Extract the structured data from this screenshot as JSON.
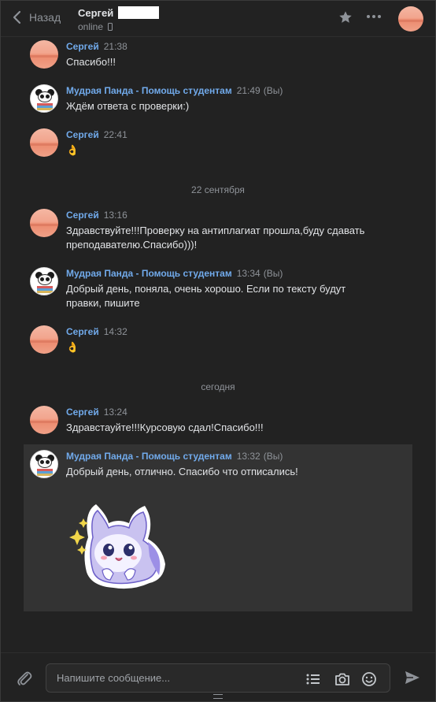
{
  "header": {
    "back_label": "Назад",
    "peer_name": "Сергей",
    "peer_status": "online"
  },
  "messages": [
    {
      "author": "Сергей",
      "time": "21:38",
      "you": "",
      "text": "Спасибо!!!",
      "avatar": "sunset-avatar"
    },
    {
      "author": "Мудрая Панда - Помощь студентам",
      "time": "21:49",
      "you": "(Вы)",
      "text": "Ждём ответа с проверки:)",
      "avatar": "panda-avatar"
    },
    {
      "author": "Сергей",
      "time": "22:41",
      "you": "",
      "text": "👌",
      "avatar": "sunset-avatar"
    },
    {
      "author": "Сергей",
      "time": "13:16",
      "you": "",
      "text": "Здравствуйте!!!Проверку на антиплагиат прошла,буду сдавать преподавателю.Спасибо)))!",
      "avatar": "sunset-avatar"
    },
    {
      "author": "Мудрая Панда - Помощь студентам",
      "time": "13:34",
      "you": "(Вы)",
      "text": "Добрый день, поняла, очень хорошо. Если по тексту будут правки, пишите",
      "avatar": "panda-avatar"
    },
    {
      "author": "Сергей",
      "time": "14:32",
      "you": "",
      "text": "👌",
      "avatar": "sunset-avatar"
    },
    {
      "author": "Сергей",
      "time": "13:24",
      "you": "",
      "text": "Здравстауйте!!!Курсовую сдал!Спасибо!!!",
      "avatar": "sunset-avatar"
    },
    {
      "author": "Мудрая Панда - Помощь студентам",
      "time": "13:32",
      "you": "(Вы)",
      "text": "Добрый день, отлично. Спасибо что отписались!",
      "avatar": "panda-avatar"
    }
  ],
  "date_separators": [
    "22 сентября",
    "сегодня"
  ],
  "composer": {
    "placeholder": "Напишите сообщение..."
  },
  "icons": {
    "back": "chevron-left-icon",
    "favorite": "star-icon",
    "more": "more-dots-icon",
    "attach": "paperclip-icon",
    "templates": "list-icon",
    "camera": "camera-icon",
    "emoji": "smile-icon",
    "send": "send-icon",
    "mobile": "phone-icon"
  },
  "colors": {
    "background": "#222222",
    "link": "#71aaeb",
    "muted": "#8f9399",
    "text": "#e1e3e6",
    "selected": "#333333"
  }
}
